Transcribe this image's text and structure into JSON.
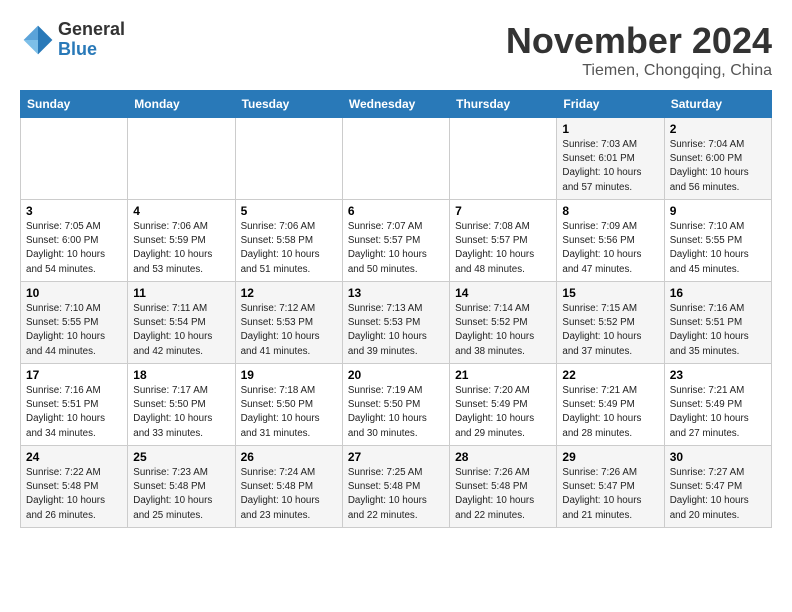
{
  "header": {
    "logo_general": "General",
    "logo_blue": "Blue",
    "month_year": "November 2024",
    "location": "Tiemen, Chongqing, China"
  },
  "weekdays": [
    "Sunday",
    "Monday",
    "Tuesday",
    "Wednesday",
    "Thursday",
    "Friday",
    "Saturday"
  ],
  "weeks": [
    [
      {
        "day": "",
        "sunrise": "",
        "sunset": "",
        "daylight": ""
      },
      {
        "day": "",
        "sunrise": "",
        "sunset": "",
        "daylight": ""
      },
      {
        "day": "",
        "sunrise": "",
        "sunset": "",
        "daylight": ""
      },
      {
        "day": "",
        "sunrise": "",
        "sunset": "",
        "daylight": ""
      },
      {
        "day": "",
        "sunrise": "",
        "sunset": "",
        "daylight": ""
      },
      {
        "day": "1",
        "sunrise": "Sunrise: 7:03 AM",
        "sunset": "Sunset: 6:01 PM",
        "daylight": "Daylight: 10 hours and 57 minutes."
      },
      {
        "day": "2",
        "sunrise": "Sunrise: 7:04 AM",
        "sunset": "Sunset: 6:00 PM",
        "daylight": "Daylight: 10 hours and 56 minutes."
      }
    ],
    [
      {
        "day": "3",
        "sunrise": "Sunrise: 7:05 AM",
        "sunset": "Sunset: 6:00 PM",
        "daylight": "Daylight: 10 hours and 54 minutes."
      },
      {
        "day": "4",
        "sunrise": "Sunrise: 7:06 AM",
        "sunset": "Sunset: 5:59 PM",
        "daylight": "Daylight: 10 hours and 53 minutes."
      },
      {
        "day": "5",
        "sunrise": "Sunrise: 7:06 AM",
        "sunset": "Sunset: 5:58 PM",
        "daylight": "Daylight: 10 hours and 51 minutes."
      },
      {
        "day": "6",
        "sunrise": "Sunrise: 7:07 AM",
        "sunset": "Sunset: 5:57 PM",
        "daylight": "Daylight: 10 hours and 50 minutes."
      },
      {
        "day": "7",
        "sunrise": "Sunrise: 7:08 AM",
        "sunset": "Sunset: 5:57 PM",
        "daylight": "Daylight: 10 hours and 48 minutes."
      },
      {
        "day": "8",
        "sunrise": "Sunrise: 7:09 AM",
        "sunset": "Sunset: 5:56 PM",
        "daylight": "Daylight: 10 hours and 47 minutes."
      },
      {
        "day": "9",
        "sunrise": "Sunrise: 7:10 AM",
        "sunset": "Sunset: 5:55 PM",
        "daylight": "Daylight: 10 hours and 45 minutes."
      }
    ],
    [
      {
        "day": "10",
        "sunrise": "Sunrise: 7:10 AM",
        "sunset": "Sunset: 5:55 PM",
        "daylight": "Daylight: 10 hours and 44 minutes."
      },
      {
        "day": "11",
        "sunrise": "Sunrise: 7:11 AM",
        "sunset": "Sunset: 5:54 PM",
        "daylight": "Daylight: 10 hours and 42 minutes."
      },
      {
        "day": "12",
        "sunrise": "Sunrise: 7:12 AM",
        "sunset": "Sunset: 5:53 PM",
        "daylight": "Daylight: 10 hours and 41 minutes."
      },
      {
        "day": "13",
        "sunrise": "Sunrise: 7:13 AM",
        "sunset": "Sunset: 5:53 PM",
        "daylight": "Daylight: 10 hours and 39 minutes."
      },
      {
        "day": "14",
        "sunrise": "Sunrise: 7:14 AM",
        "sunset": "Sunset: 5:52 PM",
        "daylight": "Daylight: 10 hours and 38 minutes."
      },
      {
        "day": "15",
        "sunrise": "Sunrise: 7:15 AM",
        "sunset": "Sunset: 5:52 PM",
        "daylight": "Daylight: 10 hours and 37 minutes."
      },
      {
        "day": "16",
        "sunrise": "Sunrise: 7:16 AM",
        "sunset": "Sunset: 5:51 PM",
        "daylight": "Daylight: 10 hours and 35 minutes."
      }
    ],
    [
      {
        "day": "17",
        "sunrise": "Sunrise: 7:16 AM",
        "sunset": "Sunset: 5:51 PM",
        "daylight": "Daylight: 10 hours and 34 minutes."
      },
      {
        "day": "18",
        "sunrise": "Sunrise: 7:17 AM",
        "sunset": "Sunset: 5:50 PM",
        "daylight": "Daylight: 10 hours and 33 minutes."
      },
      {
        "day": "19",
        "sunrise": "Sunrise: 7:18 AM",
        "sunset": "Sunset: 5:50 PM",
        "daylight": "Daylight: 10 hours and 31 minutes."
      },
      {
        "day": "20",
        "sunrise": "Sunrise: 7:19 AM",
        "sunset": "Sunset: 5:50 PM",
        "daylight": "Daylight: 10 hours and 30 minutes."
      },
      {
        "day": "21",
        "sunrise": "Sunrise: 7:20 AM",
        "sunset": "Sunset: 5:49 PM",
        "daylight": "Daylight: 10 hours and 29 minutes."
      },
      {
        "day": "22",
        "sunrise": "Sunrise: 7:21 AM",
        "sunset": "Sunset: 5:49 PM",
        "daylight": "Daylight: 10 hours and 28 minutes."
      },
      {
        "day": "23",
        "sunrise": "Sunrise: 7:21 AM",
        "sunset": "Sunset: 5:49 PM",
        "daylight": "Daylight: 10 hours and 27 minutes."
      }
    ],
    [
      {
        "day": "24",
        "sunrise": "Sunrise: 7:22 AM",
        "sunset": "Sunset: 5:48 PM",
        "daylight": "Daylight: 10 hours and 26 minutes."
      },
      {
        "day": "25",
        "sunrise": "Sunrise: 7:23 AM",
        "sunset": "Sunset: 5:48 PM",
        "daylight": "Daylight: 10 hours and 25 minutes."
      },
      {
        "day": "26",
        "sunrise": "Sunrise: 7:24 AM",
        "sunset": "Sunset: 5:48 PM",
        "daylight": "Daylight: 10 hours and 23 minutes."
      },
      {
        "day": "27",
        "sunrise": "Sunrise: 7:25 AM",
        "sunset": "Sunset: 5:48 PM",
        "daylight": "Daylight: 10 hours and 22 minutes."
      },
      {
        "day": "28",
        "sunrise": "Sunrise: 7:26 AM",
        "sunset": "Sunset: 5:48 PM",
        "daylight": "Daylight: 10 hours and 22 minutes."
      },
      {
        "day": "29",
        "sunrise": "Sunrise: 7:26 AM",
        "sunset": "Sunset: 5:47 PM",
        "daylight": "Daylight: 10 hours and 21 minutes."
      },
      {
        "day": "30",
        "sunrise": "Sunrise: 7:27 AM",
        "sunset": "Sunset: 5:47 PM",
        "daylight": "Daylight: 10 hours and 20 minutes."
      }
    ]
  ]
}
